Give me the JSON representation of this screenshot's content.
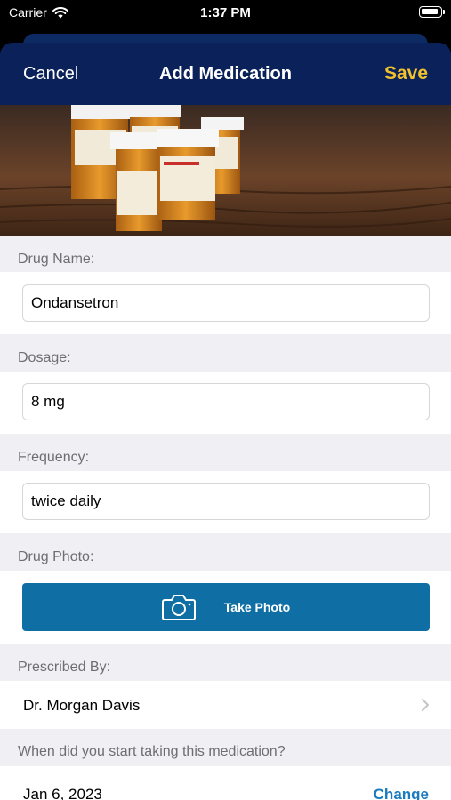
{
  "status_bar": {
    "carrier": "Carrier",
    "time": "1:37 PM"
  },
  "nav": {
    "cancel": "Cancel",
    "title": "Add Medication",
    "save": "Save",
    "save_color": "#f2c12e",
    "bg_color": "#0a2259"
  },
  "form": {
    "drug_name": {
      "label": "Drug Name:",
      "value": "Ondansetron"
    },
    "dosage": {
      "label": "Dosage:",
      "value": "8 mg"
    },
    "frequency": {
      "label": "Frequency:",
      "value": "twice daily"
    },
    "drug_photo": {
      "label": "Drug Photo:",
      "button": "Take Photo",
      "icon": "camera-icon"
    },
    "prescribed_by": {
      "label": "Prescribed By:",
      "value": "Dr. Morgan Davis",
      "icon": "chevron-right-icon"
    },
    "start_date": {
      "label": "When did you start taking this medication?",
      "value": "Jan 6, 2023",
      "action": "Change"
    }
  }
}
